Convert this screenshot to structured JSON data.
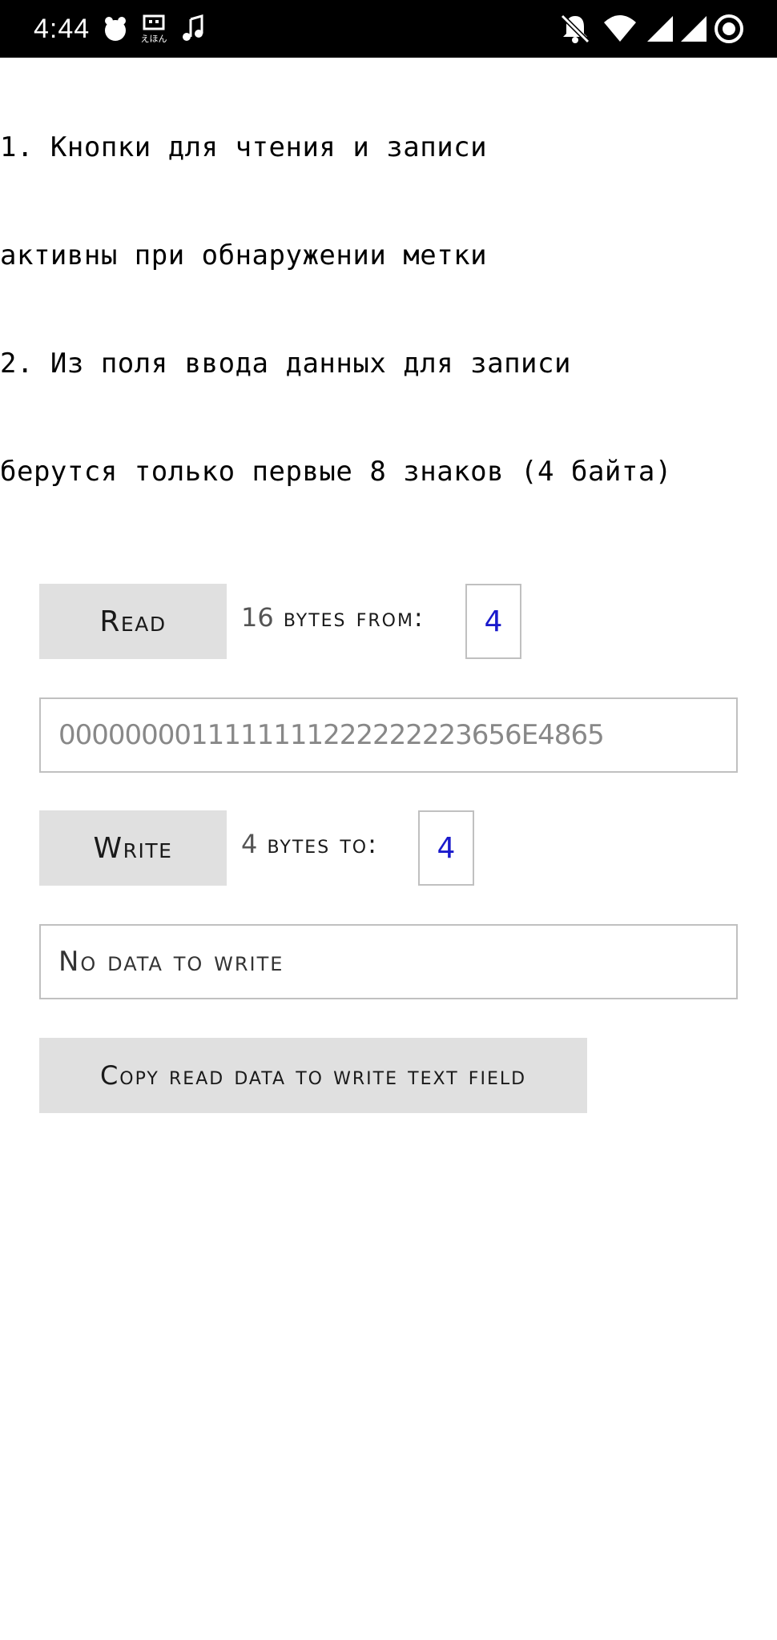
{
  "status_bar": {
    "time": "4:44",
    "left_icons": [
      "app-notification-icon",
      "app-notification-icon",
      "music-note-icon"
    ],
    "right_icons": [
      "notifications-off-icon",
      "wifi-icon",
      "signal-icon",
      "signal-icon",
      "sync-icon"
    ]
  },
  "instructions": {
    "line1": "1. Кнопки для чтения и записи",
    "line2": "активны при обнаружении метки",
    "line3": "2. Из поля ввода данных для записи",
    "line4": "берутся только первые 8 знаков (4 байта)"
  },
  "read_section": {
    "button_label": "Read",
    "count": "16",
    "suffix": "bytes from:",
    "page_value": "4",
    "data_value": "0000000011111111222222223656E4865"
  },
  "write_section": {
    "button_label": "Write",
    "count": "4",
    "suffix": "bytes to:",
    "page_value": "4",
    "data_value": "No data to write"
  },
  "copy_button_label": "Copy read data to write text field",
  "colors": {
    "status_bar_bg": "#000000",
    "button_bg": "#e0e0e0",
    "field_border": "#c0c0c0",
    "number_text": "#1a1acc"
  }
}
